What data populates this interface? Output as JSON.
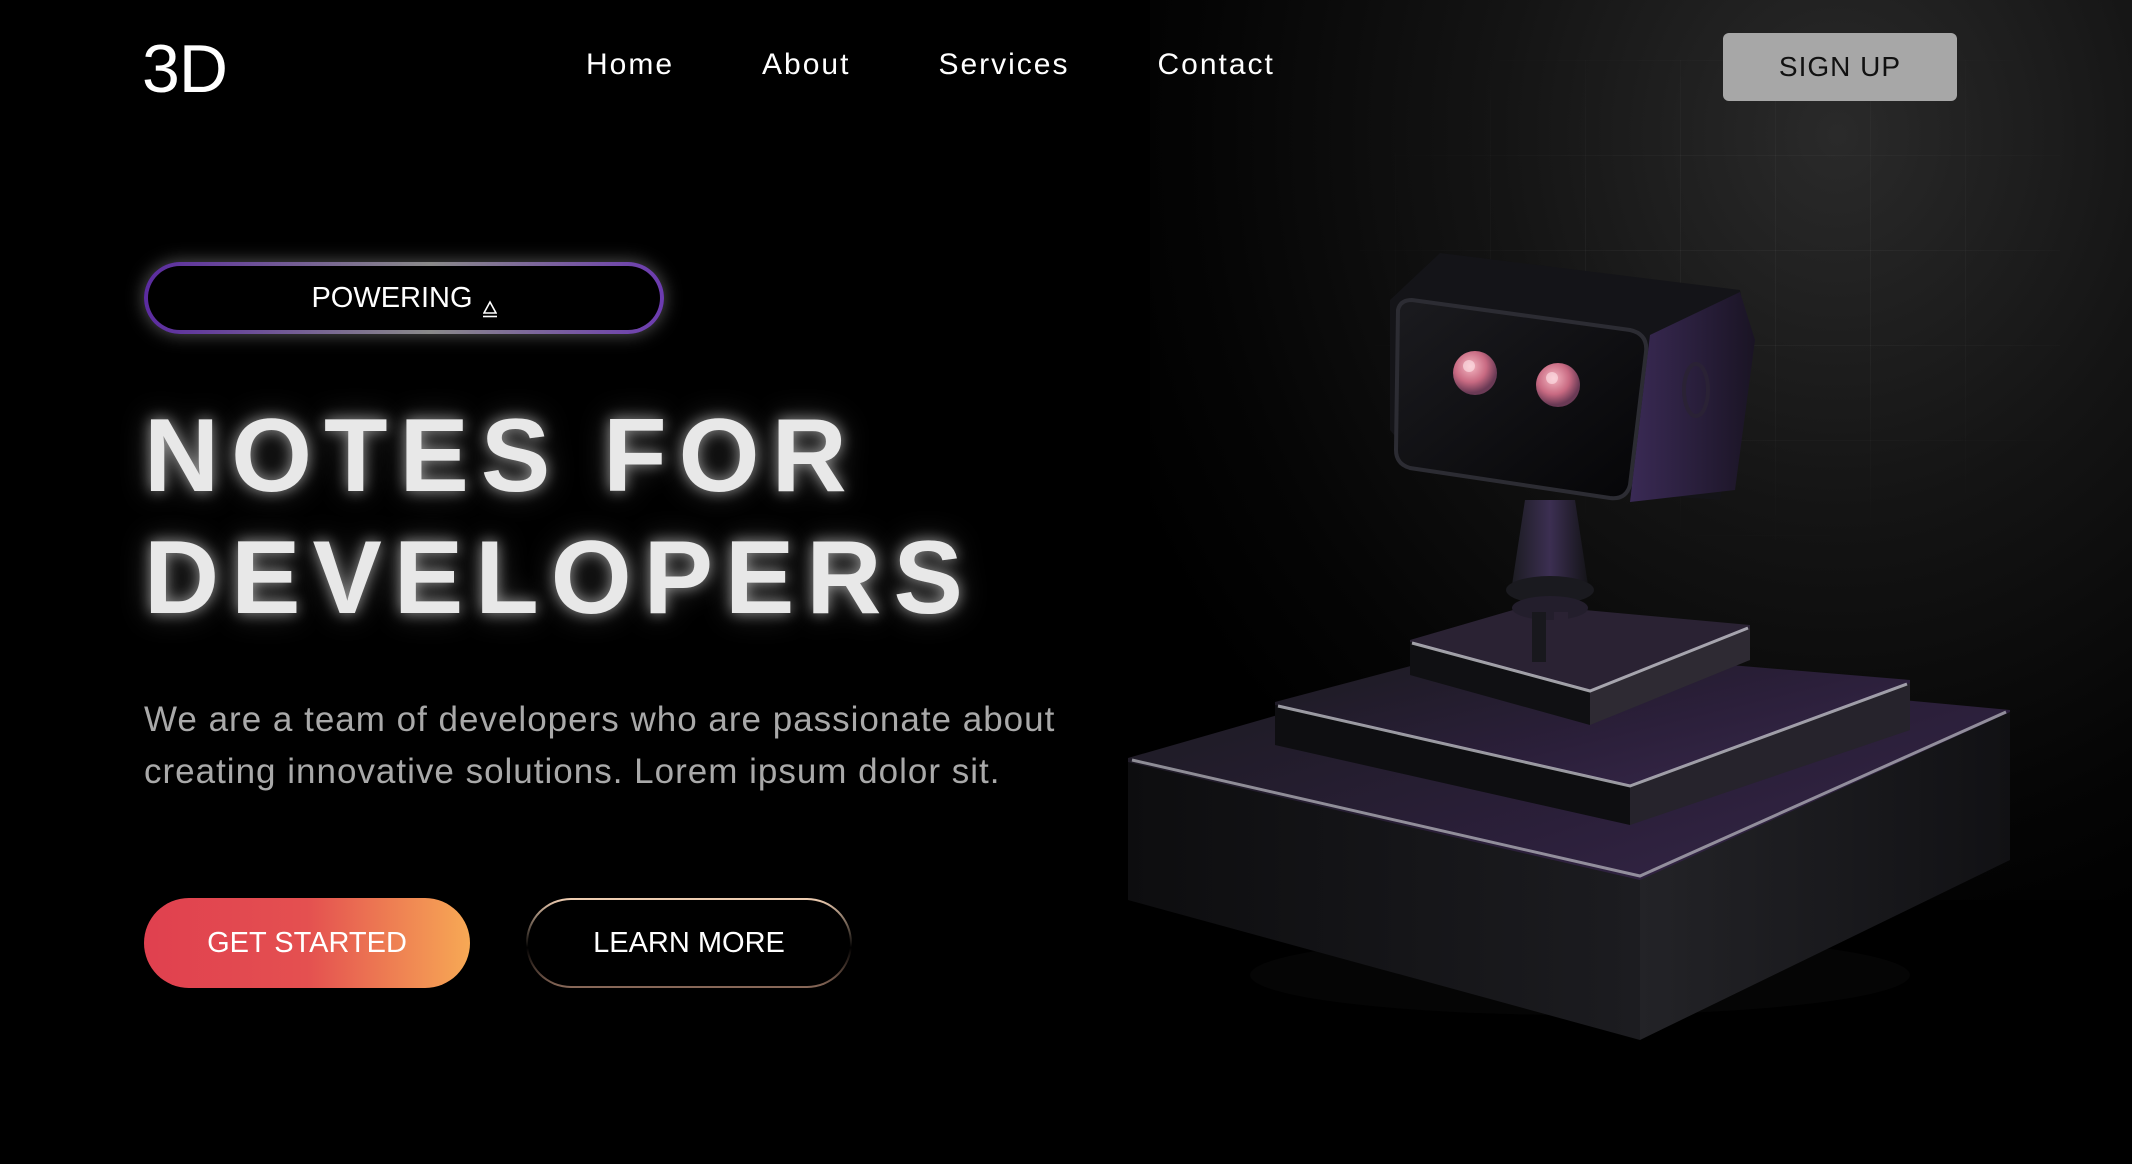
{
  "header": {
    "logo": "3D",
    "nav": [
      {
        "label": "Home"
      },
      {
        "label": "About"
      },
      {
        "label": "Services"
      },
      {
        "label": "Contact"
      }
    ],
    "signup_label": "SIGN UP"
  },
  "hero": {
    "badge_label": "POWERING",
    "badge_icon": "triangle-warning-icon",
    "headline_line1": "NOTES FOR",
    "headline_line2": "DEVELOPERS",
    "subtitle_line1": "We are a team of developers who are passionate about",
    "subtitle_line2": "creating innovative solutions. Lorem ipsum dolor sit.",
    "primary_cta": "GET STARTED",
    "secondary_cta": "LEARN MORE"
  },
  "illustration": {
    "name": "robot-on-pedestal",
    "accent_color": "#2a1a3e",
    "eye_color": "#e08a9a"
  },
  "colors": {
    "background": "#000000",
    "signup_bg": "#a7a7a7",
    "cta_gradient_start": "#e0404f",
    "cta_gradient_end": "#f7a955",
    "badge_border_purple": "#5b2ba0"
  }
}
